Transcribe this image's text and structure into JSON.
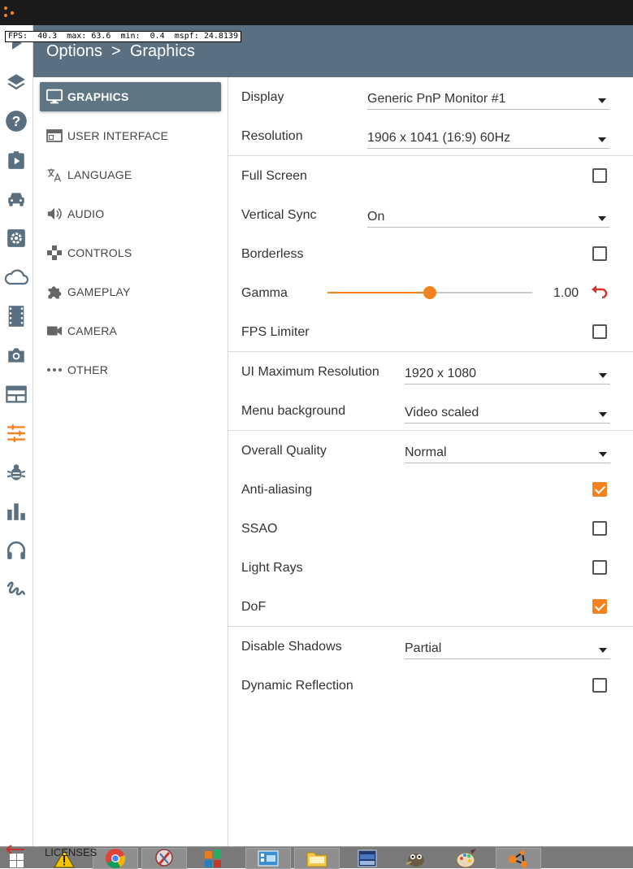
{
  "fps_overlay": "FPS:  40.3  max: 63.6  min:  0.4  mspf: 24.8139",
  "header": {
    "breadcrumb": "Options  >  Graphics"
  },
  "iconbar": [
    {
      "name": "play-icon"
    },
    {
      "name": "layers-icon"
    },
    {
      "name": "help-icon"
    },
    {
      "name": "clipboard-play-icon"
    },
    {
      "name": "car-icon"
    },
    {
      "name": "settings-box-icon"
    },
    {
      "name": "cloud-icon"
    },
    {
      "name": "film-icon"
    },
    {
      "name": "camera-icon"
    },
    {
      "name": "window-icon"
    },
    {
      "name": "sliders-icon",
      "active": true
    },
    {
      "name": "bug-icon"
    },
    {
      "name": "bar-chart-icon"
    },
    {
      "name": "headphones-icon"
    },
    {
      "name": "signature-icon"
    }
  ],
  "nav": {
    "items": [
      {
        "label": "GRAPHICS",
        "icon": "monitor-icon",
        "active": true
      },
      {
        "label": "USER INTERFACE",
        "icon": "browser-window-icon"
      },
      {
        "label": "LANGUAGE",
        "icon": "translate-icon"
      },
      {
        "label": "AUDIO",
        "icon": "speaker-icon"
      },
      {
        "label": "CONTROLS",
        "icon": "gamepad-icon"
      },
      {
        "label": "GAMEPLAY",
        "icon": "puzzle-icon"
      },
      {
        "label": "CAMERA",
        "icon": "video-camera-icon"
      },
      {
        "label": "OTHER",
        "icon": "more-dots-icon"
      }
    ]
  },
  "settings": {
    "display": {
      "label": "Display",
      "value": "Generic PnP Monitor #1"
    },
    "resolution": {
      "label": "Resolution",
      "value": "1906 x 1041 (16:9) 60Hz"
    },
    "full_screen": {
      "label": "Full Screen",
      "checked": false
    },
    "vertical_sync": {
      "label": "Vertical Sync",
      "value": "On"
    },
    "borderless": {
      "label": "Borderless",
      "checked": false
    },
    "gamma": {
      "label": "Gamma",
      "value": "1.00",
      "slider_fraction": 0.5
    },
    "fps_limiter": {
      "label": "FPS Limiter",
      "checked": false
    },
    "ui_max_resolution": {
      "label": "UI Maximum Resolution",
      "value": "1920 x 1080"
    },
    "menu_background": {
      "label": "Menu background",
      "value": "Video scaled"
    },
    "overall_quality": {
      "label": "Overall Quality",
      "value": "Normal"
    },
    "anti_aliasing": {
      "label": "Anti-aliasing",
      "checked": true
    },
    "ssao": {
      "label": "SSAO",
      "checked": false
    },
    "light_rays": {
      "label": "Light Rays",
      "checked": false
    },
    "dof": {
      "label": "DoF",
      "checked": true
    },
    "disable_shadows": {
      "label": "Disable Shadows",
      "value": "Partial"
    },
    "dynamic_reflection": {
      "label": "Dynamic Reflection",
      "checked": false
    }
  },
  "footer": {
    "licenses_label": "LICENSES"
  },
  "colors": {
    "accent": "#f58220",
    "header_bg": "#5a7080",
    "nav_active_bg": "#5e7583"
  }
}
